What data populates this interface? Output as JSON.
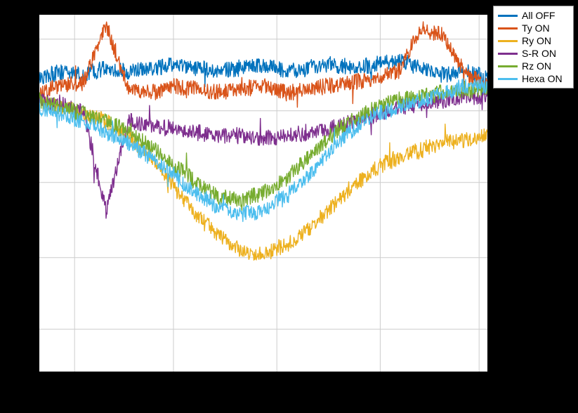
{
  "chart_data": {
    "type": "line",
    "title": "",
    "xlabel": "",
    "ylabel": "",
    "xlim": [
      0,
      640
    ],
    "ylim": [
      0,
      510
    ],
    "x_gridlines": [
      0.08,
      0.3,
      0.53,
      0.76,
      0.98
    ],
    "y_gridlines": [
      0.07,
      0.27,
      0.47,
      0.68,
      0.88
    ],
    "x_axis_type": "log",
    "y_axis_type": "log",
    "note": "No axis tick labels or titles are visible in the cropped image; values below are normalized plot-area coordinates (0..1), y=0 at top, estimated from pixel positions of the noisy series envelopes.",
    "series": [
      {
        "name": "All OFF",
        "color": "#0072bd",
        "x": [
          0.0,
          0.05,
          0.1,
          0.15,
          0.2,
          0.25,
          0.3,
          0.35,
          0.4,
          0.45,
          0.5,
          0.55,
          0.6,
          0.65,
          0.7,
          0.75,
          0.8,
          0.85,
          0.9,
          0.95,
          1.0
        ],
        "y": [
          0.18,
          0.16,
          0.17,
          0.15,
          0.16,
          0.15,
          0.14,
          0.15,
          0.16,
          0.15,
          0.14,
          0.16,
          0.15,
          0.14,
          0.15,
          0.14,
          0.13,
          0.15,
          0.17,
          0.16,
          0.18
        ]
      },
      {
        "name": "Ty ON",
        "color": "#d95319",
        "x": [
          0.0,
          0.05,
          0.1,
          0.15,
          0.2,
          0.25,
          0.3,
          0.35,
          0.4,
          0.45,
          0.5,
          0.55,
          0.6,
          0.65,
          0.7,
          0.75,
          0.8,
          0.85,
          0.9,
          0.95,
          1.0
        ],
        "y": [
          0.22,
          0.2,
          0.19,
          0.03,
          0.21,
          0.22,
          0.2,
          0.21,
          0.22,
          0.21,
          0.2,
          0.22,
          0.21,
          0.2,
          0.19,
          0.18,
          0.16,
          0.04,
          0.06,
          0.17,
          0.2
        ]
      },
      {
        "name": "Ry ON",
        "color": "#edb120",
        "x": [
          0.0,
          0.05,
          0.1,
          0.15,
          0.2,
          0.25,
          0.3,
          0.35,
          0.4,
          0.45,
          0.5,
          0.55,
          0.6,
          0.65,
          0.7,
          0.75,
          0.8,
          0.85,
          0.9,
          0.95,
          1.0
        ],
        "y": [
          0.24,
          0.26,
          0.28,
          0.3,
          0.34,
          0.4,
          0.48,
          0.56,
          0.62,
          0.66,
          0.67,
          0.65,
          0.6,
          0.54,
          0.48,
          0.43,
          0.4,
          0.38,
          0.36,
          0.35,
          0.34
        ]
      },
      {
        "name": "S-R ON",
        "color": "#7e2f8e",
        "x": [
          0.0,
          0.05,
          0.1,
          0.15,
          0.2,
          0.25,
          0.3,
          0.35,
          0.4,
          0.45,
          0.5,
          0.55,
          0.6,
          0.65,
          0.7,
          0.75,
          0.8,
          0.85,
          0.9,
          0.95,
          1.0
        ],
        "y": [
          0.24,
          0.25,
          0.27,
          0.55,
          0.3,
          0.31,
          0.32,
          0.33,
          0.34,
          0.34,
          0.35,
          0.34,
          0.33,
          0.32,
          0.3,
          0.28,
          0.26,
          0.25,
          0.24,
          0.23,
          0.23
        ]
      },
      {
        "name": "Rz ON",
        "color": "#77ac30",
        "x": [
          0.0,
          0.05,
          0.1,
          0.15,
          0.2,
          0.25,
          0.3,
          0.35,
          0.4,
          0.45,
          0.5,
          0.55,
          0.6,
          0.65,
          0.7,
          0.75,
          0.8,
          0.85,
          0.9,
          0.95,
          1.0
        ],
        "y": [
          0.24,
          0.26,
          0.28,
          0.3,
          0.33,
          0.37,
          0.42,
          0.47,
          0.51,
          0.52,
          0.5,
          0.46,
          0.4,
          0.34,
          0.29,
          0.26,
          0.24,
          0.23,
          0.22,
          0.21,
          0.21
        ]
      },
      {
        "name": "Hexa ON",
        "color": "#4dbeee",
        "x": [
          0.0,
          0.05,
          0.1,
          0.15,
          0.2,
          0.25,
          0.3,
          0.35,
          0.4,
          0.45,
          0.5,
          0.55,
          0.6,
          0.65,
          0.7,
          0.75,
          0.8,
          0.85,
          0.9,
          0.95,
          1.0
        ],
        "y": [
          0.26,
          0.28,
          0.3,
          0.33,
          0.36,
          0.4,
          0.45,
          0.5,
          0.54,
          0.56,
          0.55,
          0.51,
          0.45,
          0.38,
          0.32,
          0.28,
          0.26,
          0.24,
          0.22,
          0.2,
          0.2
        ]
      }
    ],
    "legend": {
      "position": "outside-right-top",
      "entries": [
        "All OFF",
        "Ty ON",
        "Ry ON",
        "S-R ON",
        "Rz ON",
        "Hexa ON"
      ]
    }
  }
}
